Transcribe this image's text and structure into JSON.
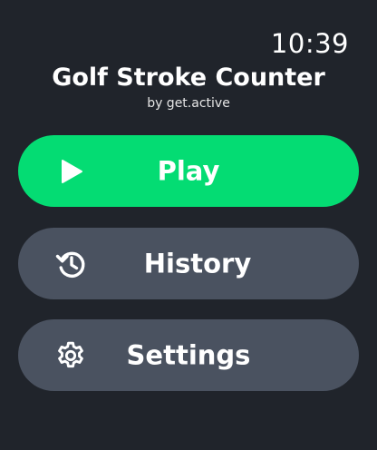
{
  "status": {
    "time": "10:39"
  },
  "header": {
    "title": "Golf Stroke Counter",
    "subtitle": "by get.active"
  },
  "menu": {
    "items": [
      {
        "label": "Play",
        "icon": "play-icon",
        "color": "#04dc73"
      },
      {
        "label": "History",
        "icon": "history-icon",
        "color": "#4a5260"
      },
      {
        "label": "Settings",
        "icon": "gear-icon",
        "color": "#4a5260"
      }
    ]
  },
  "theme": {
    "background": "#20242b",
    "accent": "#04dc73",
    "button": "#4a5260"
  }
}
